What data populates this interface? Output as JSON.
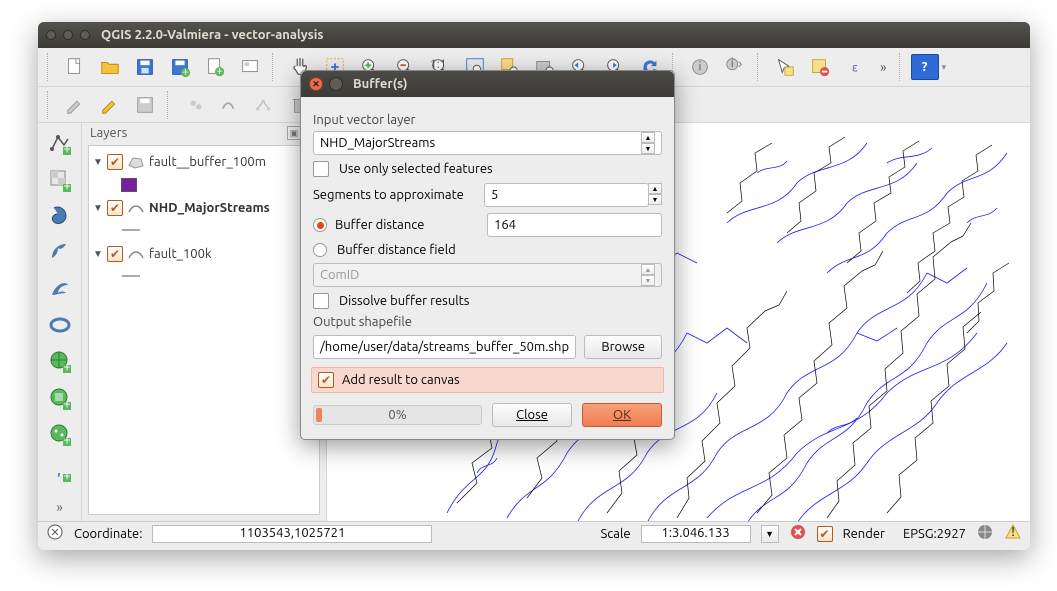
{
  "window": {
    "title": "QGIS 2.2.0-Valmiera - vector-analysis"
  },
  "layers_panel": {
    "title": "Layers"
  },
  "layers": [
    {
      "name": "fault__buffer_100m",
      "swatch": "#7b1fa2"
    },
    {
      "name": "NHD_MajorStreams"
    },
    {
      "name": "fault_100k"
    }
  ],
  "statusbar": {
    "coord_label": "Coordinate:",
    "coord_value": "1103543,1025721",
    "scale_label": "Scale",
    "scale_value": "1:3.046.133",
    "render_label": "Render",
    "epsg": "EPSG:2927"
  },
  "dialog": {
    "title": "Buffer(s)",
    "input_layer_label": "Input vector layer",
    "input_layer_value": "NHD_MajorStreams",
    "use_selected_label": "Use only selected features",
    "segments_label": "Segments to approximate",
    "segments_value": "5",
    "buffer_distance_label": "Buffer distance",
    "buffer_distance_value": "164",
    "buffer_field_label": "Buffer distance field",
    "buffer_field_value": "ComID",
    "dissolve_label": "Dissolve buffer results",
    "output_label": "Output shapefile",
    "output_value": "/home/user/data/streams_buffer_50m.shp",
    "browse_label": "Browse",
    "add_canvas_label": "Add result to canvas",
    "progress_text": "0%",
    "close_label": "Close",
    "ok_label": "OK"
  }
}
